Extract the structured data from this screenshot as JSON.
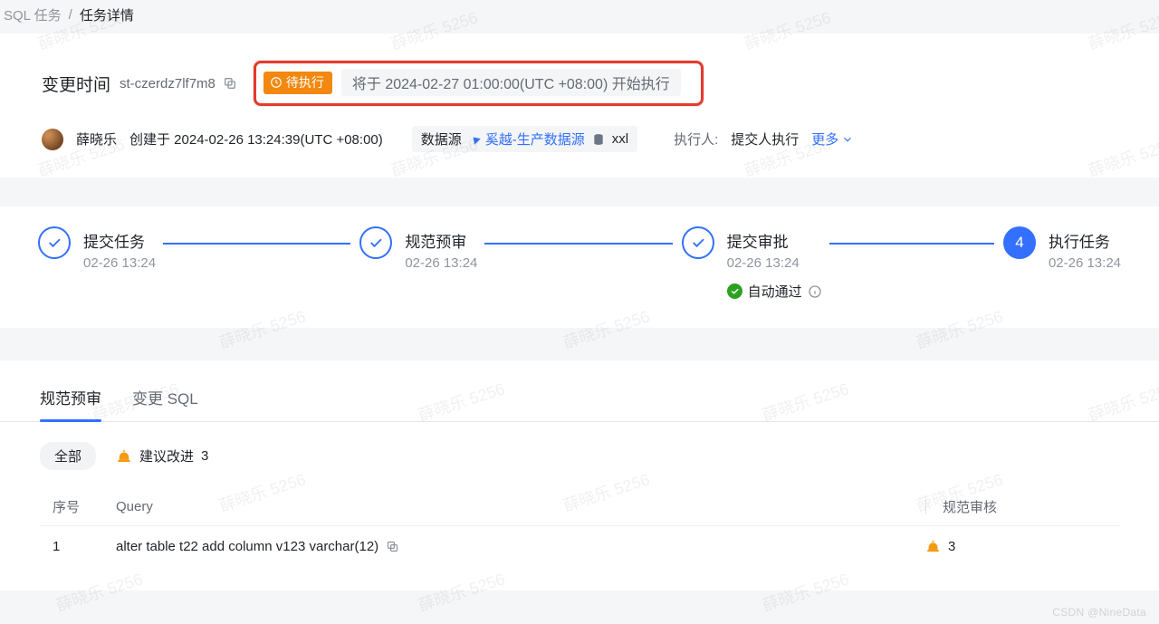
{
  "breadcrumb": {
    "parent": "SQL 任务",
    "current": "任务详情"
  },
  "header": {
    "title": "变更时间",
    "task_id": "st-czerdz7lf7m8",
    "status_badge": "待执行",
    "schedule_text": "将于 2024-02-27 01:00:00(UTC +08:00) 开始执行"
  },
  "meta": {
    "creator": "薛晓乐",
    "created_at": "创建于 2024-02-26 13:24:39(UTC +08:00)",
    "datasource_label": "数据源",
    "datasource_name": "奚越-生产数据源",
    "database_name": "xxl",
    "executor_label": "执行人:",
    "executor_value": "提交人执行",
    "more": "更多"
  },
  "steps": [
    {
      "title": "提交任务",
      "time": "02-26 13:24"
    },
    {
      "title": "规范预审",
      "time": "02-26 13:24"
    },
    {
      "title": "提交审批",
      "time": "02-26 13:24",
      "extra": "自动通过"
    },
    {
      "title": "执行任务",
      "time": "02-26 13:24",
      "number": "4"
    }
  ],
  "tabs": [
    {
      "label": "规范预审",
      "active": true
    },
    {
      "label": "变更 SQL",
      "active": false
    }
  ],
  "filters": {
    "all": "全部",
    "suggest_label": "建议改进",
    "suggest_count": "3"
  },
  "table": {
    "headers": {
      "idx": "序号",
      "query": "Query",
      "audit": "规范审核"
    },
    "rows": [
      {
        "idx": "1",
        "query": "alter table t22 add column v123 varchar(12)",
        "audit_count": "3"
      }
    ]
  },
  "icons": {
    "copy": "copy-icon",
    "clock": "clock-icon",
    "link": "link-icon",
    "db": "database-icon",
    "chevron_down": "chevron-down-icon",
    "check": "check-icon",
    "info": "info-icon",
    "alarm": "alarm-icon"
  },
  "watermark_text": "薛晓乐 5256",
  "csdn_attr": "CSDN @NineData"
}
